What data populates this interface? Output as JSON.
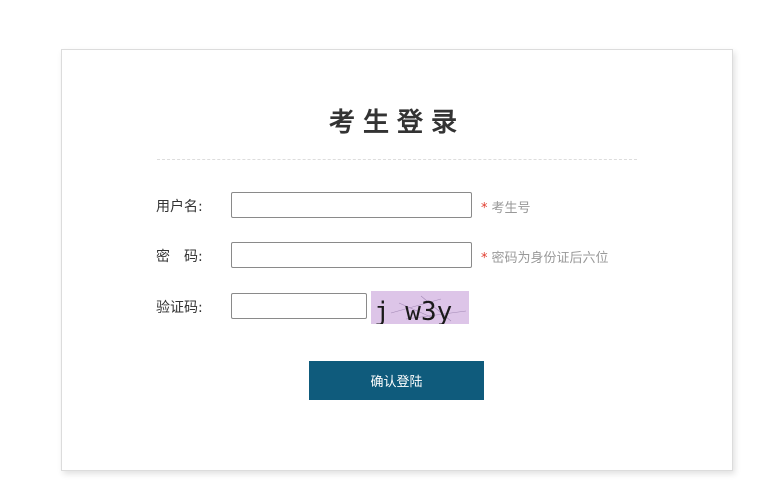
{
  "form": {
    "title": "考生登录",
    "username_label": "用户名:",
    "password_label": "密　码:",
    "captcha_label": "验证码:",
    "username_value": "",
    "password_value": "",
    "captcha_value": "",
    "required_mark": "*",
    "username_hint": "考生号",
    "password_hint": "密码为身份证后六位",
    "captcha_image_text": "j w3y",
    "submit_label": "确认登陆"
  },
  "colors": {
    "accent": "#0f5b7c",
    "required": "#e0392b",
    "hint": "#999999",
    "captcha_bg": "#ddc5e8"
  }
}
